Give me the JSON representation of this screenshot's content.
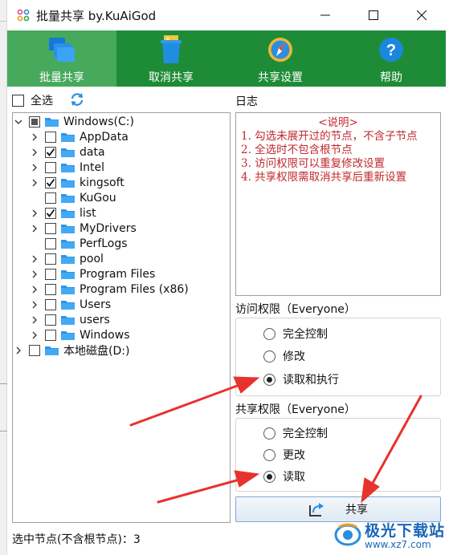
{
  "window": {
    "title": "批量共享 by.KuAiGod"
  },
  "toolbar": {
    "tabs": [
      {
        "label": "批量共享",
        "icon": "folders-icon",
        "active": true
      },
      {
        "label": "取消共享",
        "icon": "recycle-bin-icon",
        "active": false
      },
      {
        "label": "共享设置",
        "icon": "compass-icon",
        "active": false
      },
      {
        "label": "帮助",
        "icon": "help-icon",
        "active": false
      }
    ]
  },
  "left": {
    "select_all_label": "全选",
    "tree": [
      {
        "label": "Windows(C:)",
        "level": 0,
        "expander": "expanded",
        "check": "partial"
      },
      {
        "label": "AppData",
        "level": 1,
        "expander": "collapsed",
        "check": "unchecked"
      },
      {
        "label": "data",
        "level": 1,
        "expander": "collapsed",
        "check": "checked"
      },
      {
        "label": "Intel",
        "level": 1,
        "expander": "collapsed",
        "check": "unchecked"
      },
      {
        "label": "kingsoft",
        "level": 1,
        "expander": "collapsed",
        "check": "checked"
      },
      {
        "label": "KuGou",
        "level": 1,
        "expander": "none",
        "check": "unchecked"
      },
      {
        "label": "list",
        "level": 1,
        "expander": "collapsed",
        "check": "checked"
      },
      {
        "label": "MyDrivers",
        "level": 1,
        "expander": "collapsed",
        "check": "unchecked"
      },
      {
        "label": "PerfLogs",
        "level": 1,
        "expander": "none",
        "check": "unchecked"
      },
      {
        "label": "pool",
        "level": 1,
        "expander": "collapsed",
        "check": "unchecked"
      },
      {
        "label": "Program Files",
        "level": 1,
        "expander": "collapsed",
        "check": "unchecked"
      },
      {
        "label": "Program Files (x86)",
        "level": 1,
        "expander": "collapsed",
        "check": "unchecked"
      },
      {
        "label": "Users",
        "level": 1,
        "expander": "collapsed",
        "check": "unchecked"
      },
      {
        "label": "users",
        "level": 1,
        "expander": "collapsed",
        "check": "unchecked"
      },
      {
        "label": "Windows",
        "level": 1,
        "expander": "collapsed",
        "check": "unchecked"
      },
      {
        "label": "本地磁盘(D:)",
        "level": 0,
        "expander": "collapsed",
        "check": "unchecked"
      }
    ],
    "status": "选中节点(不含根节点)：3"
  },
  "right": {
    "log_title": "日志",
    "log_heading": "<说明>",
    "log_lines": [
      "1. 勾选未展开过的节点，不含子节点",
      "2. 全选时不包含根节点",
      "3. 访问权限可以重复修改设置",
      "4. 共享权限需取消共享后重新设置"
    ],
    "access": {
      "title": "访问权限（Everyone）",
      "options": [
        "完全控制",
        "修改",
        "读取和执行"
      ],
      "selected": 2
    },
    "share_perm": {
      "title": "共享权限（Everyone）",
      "options": [
        "完全控制",
        "更改",
        "读取"
      ],
      "selected": 2
    },
    "share_button": "共享"
  },
  "watermark": {
    "brand": "极光下载站",
    "url": "www.xz7.com"
  },
  "colors": {
    "toolbar_green": "#1e8c37",
    "active_tab": "#47a95c",
    "log_text": "#c0282d",
    "arrow_red": "#e8322d"
  }
}
